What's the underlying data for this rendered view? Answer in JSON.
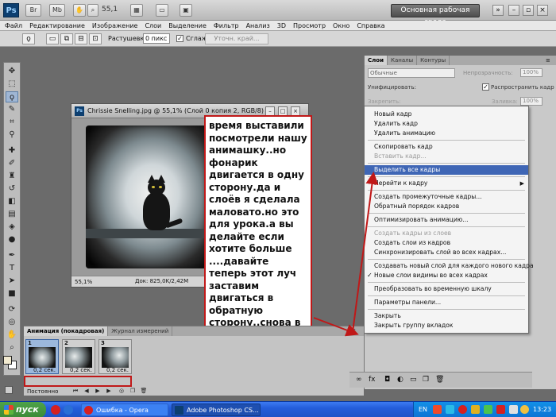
{
  "app": {
    "logo": "Ps",
    "mb_label": "Mb",
    "zoom_value": "55,1",
    "workspace": "Основная рабочая среда"
  },
  "menu": [
    "Файл",
    "Редактирование",
    "Изображение",
    "Слои",
    "Выделение",
    "Фильтр",
    "Анализ",
    "3D",
    "Просмотр",
    "Окно",
    "Справка"
  ],
  "options": {
    "feather_label": "Растушевка:",
    "feather_value": "0 пикс",
    "antialias_label": "Сглаживание",
    "refine_button": "Уточн. край..."
  },
  "document": {
    "title": "Chrissie Snelling.jpg @ 55,1% (Слой 0 копия 2, RGB/8) *",
    "zoom": "55,1%",
    "doc_size": "Док: 825,0K/2,42M"
  },
  "annotation": {
    "text": "время выставили посмотрели нашу анимашку..но фонарик двигается в одну сторону.да и слоёв я сделала маловато.но это для урока.а вы делайте если хотите больше ....давайте теперь этот луч заставим двигаться в обратную сторону..снова в анимации нажимаем на треугольничек и выделяем все кадры"
  },
  "layers_panel": {
    "tabs": [
      "Слои",
      "Каналы",
      "Контуры"
    ],
    "blend_mode": "Обычные",
    "opacity_label": "Непрозрачность:",
    "opacity_value": "100%",
    "unify_label": "Унифицировать:",
    "propagate_label": "Распространить кадр 1",
    "lock_label": "Закрепить:",
    "fill_label": "Заливка:",
    "fill_value": "100%"
  },
  "flyout_menu": {
    "items": [
      {
        "label": "Новый кадр",
        "state": "normal"
      },
      {
        "label": "Удалить кадр",
        "state": "normal"
      },
      {
        "label": "Удалить анимацию",
        "state": "normal"
      },
      {
        "label": "Скопировать кадр",
        "state": "normal"
      },
      {
        "label": "Вставить кадр...",
        "state": "disabled"
      },
      {
        "label": "Выделить все кадры",
        "state": "highlighted"
      },
      {
        "label": "Перейти к кадру",
        "state": "submenu"
      },
      {
        "label": "Создать промежуточные кадры...",
        "state": "normal"
      },
      {
        "label": "Обратный порядок кадров",
        "state": "normal"
      },
      {
        "label": "Оптимизировать анимацию...",
        "state": "normal"
      },
      {
        "label": "Создать кадры из слоев",
        "state": "disabled"
      },
      {
        "label": "Создать слои из кадров",
        "state": "normal"
      },
      {
        "label": "Синхронизировать слой во всех кадрах...",
        "state": "normal"
      },
      {
        "label": "Создавать новый слой для каждого нового кадра",
        "state": "normal"
      },
      {
        "label": "Новые слои видимы во всех кадрах",
        "state": "checked"
      },
      {
        "label": "Преобразовать во временную шкалу",
        "state": "normal"
      },
      {
        "label": "Параметры панели...",
        "state": "normal"
      },
      {
        "label": "Закрыть",
        "state": "normal"
      },
      {
        "label": "Закрыть группу вкладок",
        "state": "normal"
      }
    ]
  },
  "animation_panel": {
    "tabs": [
      "Анимация (покадровая)",
      "Журнал измерений"
    ],
    "frames": [
      {
        "num": "1",
        "delay": "0,2 сек."
      },
      {
        "num": "2",
        "delay": "0,2 сек."
      },
      {
        "num": "3",
        "delay": "0,2 сек."
      }
    ],
    "loop": "Постоянно"
  },
  "taskbar": {
    "start": "пуск",
    "tasks": [
      {
        "label": "Ошибка - Opera",
        "icon_color": "#d62020"
      },
      {
        "label": "Adobe Photoshop CS...",
        "icon_color": "#0d3f70"
      }
    ],
    "lang": "EN",
    "time": "13:23"
  },
  "colors": {
    "accent_red": "#c01818",
    "menu_highlight": "#3f66b5",
    "xp_blue": "#245edb"
  },
  "icons": [
    "lasso-icon",
    "move-icon",
    "marquee-icon",
    "crop-icon",
    "eyedropper-icon",
    "brush-icon",
    "stamp-icon",
    "eraser-icon",
    "gradient-icon",
    "pen-icon",
    "text-icon",
    "hand-icon",
    "zoom-icon",
    "play-icon",
    "close-icon"
  ]
}
